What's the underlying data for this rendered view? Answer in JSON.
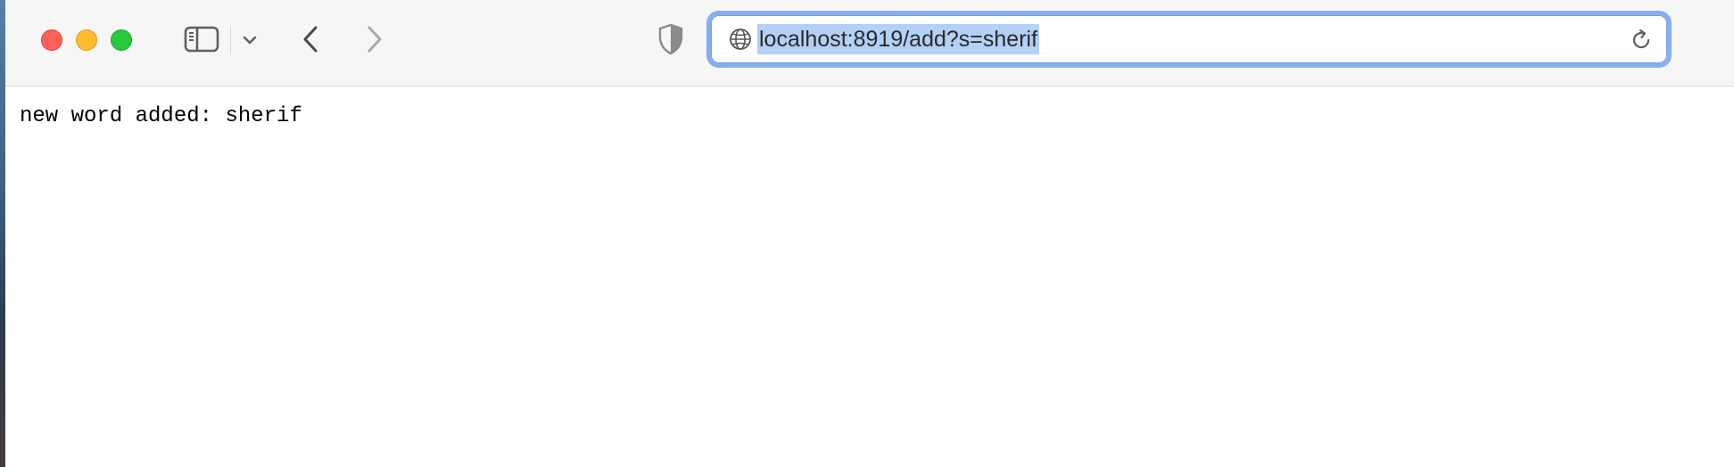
{
  "window": {
    "controls": [
      "close",
      "minimize",
      "maximize"
    ]
  },
  "toolbar": {
    "icons": {
      "sidebar": "sidebar-icon",
      "sidebar_menu": "chevron-down-icon",
      "back": "chevron-left-icon",
      "forward": "chevron-right-icon",
      "privacy": "shield-icon",
      "site": "globe-icon",
      "reload": "reload-icon"
    }
  },
  "address_bar": {
    "url": "localhost:8919/add?s=sherif",
    "selected": true,
    "focus_color": "#84aff0",
    "selection_color": "#b3d0f6"
  },
  "page": {
    "body_text": "new word added: sherif"
  },
  "colors": {
    "close": "#fe5f57",
    "minimize": "#febc2e",
    "maximize": "#28c840"
  }
}
